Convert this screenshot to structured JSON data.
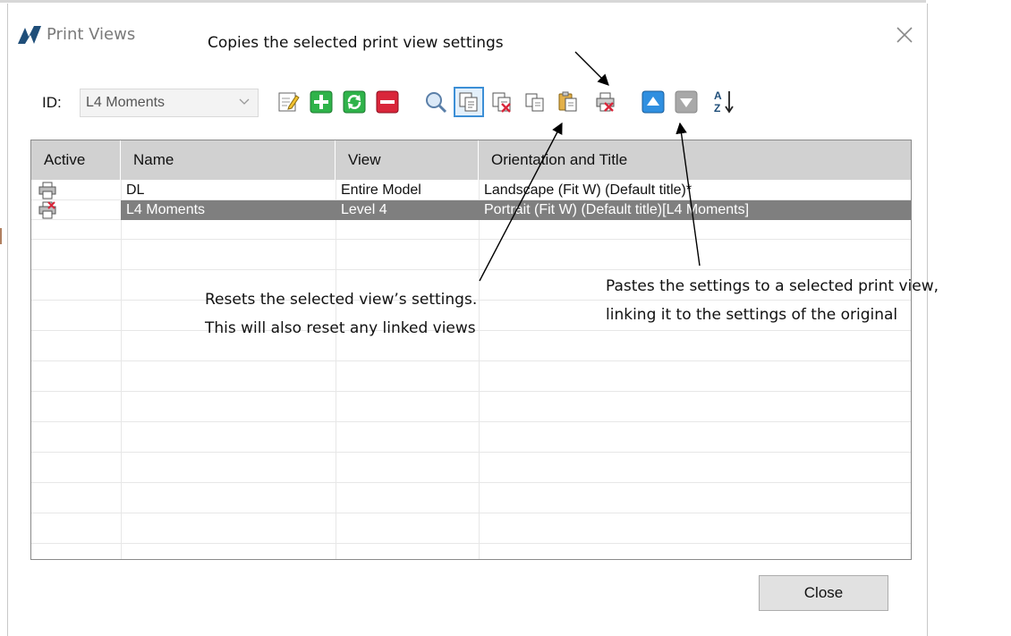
{
  "dialog": {
    "title": "Print Views",
    "close_icon": "close-icon"
  },
  "toolbar": {
    "id_label": "ID:",
    "id_value": "L4 Moments",
    "buttons": [
      {
        "name": "edit-button",
        "icon": "edit-pencil-icon"
      },
      {
        "name": "add-button",
        "icon": "plus-icon",
        "color": "#2fb34a"
      },
      {
        "name": "refresh-button",
        "icon": "refresh-icon",
        "color": "#2fb34a"
      },
      {
        "name": "delete-button",
        "icon": "minus-icon",
        "color": "#d9263a"
      },
      {
        "name": "preview-button",
        "icon": "magnifier-icon"
      },
      {
        "name": "copy-settings-button",
        "icon": "copy-settings-icon"
      },
      {
        "name": "reset-settings-button",
        "icon": "reset-settings-icon"
      },
      {
        "name": "copy-button",
        "icon": "copy-icon"
      },
      {
        "name": "paste-button",
        "icon": "paste-icon"
      },
      {
        "name": "print-button",
        "icon": "printer-x-icon"
      },
      {
        "name": "move-up-button",
        "icon": "arrow-up-icon",
        "color": "#2f8fe0"
      },
      {
        "name": "move-down-button",
        "icon": "arrow-down-icon"
      },
      {
        "name": "sort-button",
        "icon": "sort-az-icon"
      }
    ]
  },
  "table": {
    "columns": [
      "Active",
      "Name",
      "View",
      "Orientation and Title"
    ],
    "rows": [
      {
        "icon": "printer-icon",
        "name": "DL",
        "view": "Entire Model",
        "orientation": "Landscape (Fit W) (Default title)*",
        "selected": false
      },
      {
        "icon": "printer-active-icon",
        "name": "L4 Moments",
        "view": "Level 4",
        "orientation": "Portrait (Fit W) (Default title)[L4 Moments]",
        "selected": true
      }
    ]
  },
  "footer": {
    "close_label": "Close"
  },
  "annotations": {
    "copy": "Copies the selected print view settings",
    "reset_line1": "Resets the selected view’s settings.",
    "reset_line2": "This will also reset any linked views",
    "paste_line1": "Pastes the settings to a selected print view,",
    "paste_line2": "linking it to the settings of the original"
  },
  "colors": {
    "header_bg": "#d1d1d1",
    "selected_row_bg": "#7f7f7f",
    "selected_button_border": "#3c8fd6",
    "logo": "#1f4e79"
  }
}
